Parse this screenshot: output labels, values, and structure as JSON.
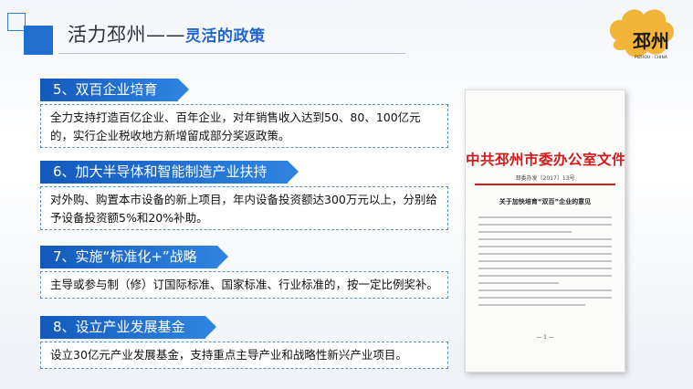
{
  "header": {
    "title_main": "活力邳州——",
    "title_sub": "灵活的政策"
  },
  "logo": {
    "text": "邳州",
    "sub": "PIZHOU · CHINA"
  },
  "sections": [
    {
      "heading": "5、双百企业培育",
      "body": "全力支持打造百亿企业、百年企业，对年销售收入达到50、80、100亿元的，实行企业税收地方新增留成部分奖返政策。"
    },
    {
      "heading": "6、加大半导体和智能制造产业扶持",
      "body": "对外购、购置本市设备的新上项目，年内设备投资额达300万元以上，分别给予设备投资额5%和20%补助。"
    },
    {
      "heading": "7、实施“标准化+”战略",
      "body": "主导或参与制（修）订国际标准、国家标准、行业标准的，按一定比例奖补。"
    },
    {
      "heading": "8、设立产业发展基金",
      "body": "设立30亿元产业发展基金，支持重点主导产业和战略性新兴产业项目。"
    }
  ],
  "document": {
    "heading": "中共邳州市委办公室文件",
    "number": "邳委办发〔2017〕13号",
    "title": "关于加快培育“双百”企业的意见",
    "page": "— 1 —"
  }
}
